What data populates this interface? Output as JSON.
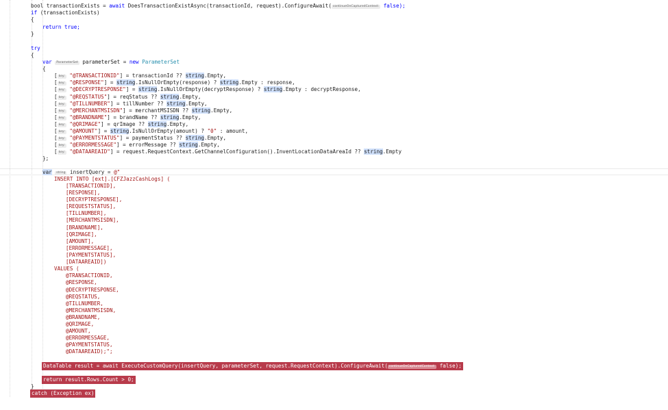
{
  "colors": {
    "background": "#ffffff",
    "keyword": "#0000ff",
    "type": "#2b91af",
    "string": "#a31515",
    "highlight": "#cfe0fb",
    "error_background": "#b83b4b",
    "inlay_hint_background": "#ececec"
  },
  "hints": {
    "key": "key:",
    "parameterset": "ParameterSet",
    "string": "string",
    "continue_on_captured_context": "continueOnCapturedContext:"
  },
  "code": {
    "l1a": "bool transactionExists = ",
    "l1b": "await",
    "l1c": " DoesTransactionExistAsync(transactionId, request).ConfigureAwait(",
    "l1d": " false);",
    "l2a": "if",
    "l2b": " (transactionExists)",
    "l3": "{",
    "l4a": "return",
    "l4b": " true;",
    "l5": "}",
    "l6": "try",
    "l7": "{",
    "l8a": "var",
    "l8b": " parameterSet = ",
    "l8c": "new",
    "l8d": " ParameterSet",
    "l9": "{",
    "p1a": " \"@TRANSACTIONID\"",
    "p1b": "] = transactionId ?? ",
    "p1c": "string",
    "p1d": ".Empty,",
    "p2a": " \"@RESPONSE\"",
    "p2b": "] = ",
    "p2c": "string",
    "p2d": ".IsNullOrEmpty(response) ? ",
    "p2e": "string",
    "p2f": ".Empty : response,",
    "p3a": " \"@DECRYPTRESPONSE\"",
    "p3b": "] = ",
    "p3c": "string",
    "p3d": ".IsNullOrEmpty(decryptResponse) ? ",
    "p3e": "string",
    "p3f": ".Empty : decryptResponse,",
    "p4a": " \"@REQSTATUS\"",
    "p4b": "] = reqStatus ?? ",
    "p4c": "string",
    "p4d": ".Empty,",
    "p5a": " \"@TILLNUMBER\"",
    "p5b": "] = tillNumber ?? ",
    "p5c": "string",
    "p5d": ".Empty,",
    "p6a": " \"@MERCHANTMSISDN\"",
    "p6b": "] = merchantMSISDN ?? ",
    "p6c": "string",
    "p6d": ".Empty,",
    "p7a": " \"@BRANDNAME\"",
    "p7b": "] = brandName ?? ",
    "p7c": "string",
    "p7d": ".Empty,",
    "p8a": " \"@QRIMAGE\"",
    "p8b": "] = qrImage ?? ",
    "p8c": "string",
    "p8d": ".Empty,",
    "p9a": " \"@AMOUNT\"",
    "p9b": "] = ",
    "p9c": "string",
    "p9d": ".IsNullOrEmpty(amount) ? ",
    "p9e": "\"0\"",
    "p9f": " : amount,",
    "p10a": " \"@PAYMENTSTATUS\"",
    "p10b": "] = paymentStatus ?? ",
    "p10c": "string",
    "p10d": ".Empty,",
    "p11a": " \"@ERRORMESSAGE\"",
    "p11b": "] = errorMessage ?? ",
    "p11c": "string",
    "p11d": ".Empty,",
    "p12a": " \"@DATAAREAID\"",
    "p12b": "] = request.RequestContext.GetChannelConfiguration().InventLocationDataAreaId ?? ",
    "p12c": "string",
    "p12d": ".Empty",
    "close_init": "};",
    "q0a": "var",
    "q0b": " insertQuery = ",
    "q0c": "@\"",
    "q1": "INSERT INTO [ext].[CFZJazzCashLogs] (",
    "c1": "[TRANSACTIONID],",
    "c2": "[RESPONSE],",
    "c3": "[DECRYPTRESPONSE],",
    "c4": "[REQUESTSTATUS],",
    "c5": "[TILLNUMBER],",
    "c6": "[MERCHANTMSISDN],",
    "c7": "[BRANDNAME],",
    "c8": "[QRIMAGE],",
    "c9": "[AMOUNT],",
    "c10": "[ERRORMESSAGE],",
    "c11": "[PAYMENTSTATUS],",
    "c12": "[DATAAREAID])",
    "values": "VALUES (",
    "v1": "@TRANSACTIONID,",
    "v2": "@RESPONSE,",
    "v3": "@DECRYPTRESPONSE,",
    "v4": "@REQSTATUS,",
    "v5": "@TILLNUMBER,",
    "v6": "@MERCHANTMSISDN,",
    "v7": "@BRANDNAME,",
    "v8": "@QRIMAGE,",
    "v9": "@AMOUNT,",
    "v10": "@ERRORMESSAGE,",
    "v11": "@PAYMENTSTATUS,",
    "v12": "@DATAAREAID);\";",
    "e1a": "DataTable result = await ExecuteCustomQuery(insertQuery, parameterSet, request.RequestContext).ConfigureAwait(",
    "e1b": " false);",
    "e2": "return result.Rows.Count > 0;",
    "close_try": "}",
    "catch": "catch (Exception ex)"
  }
}
